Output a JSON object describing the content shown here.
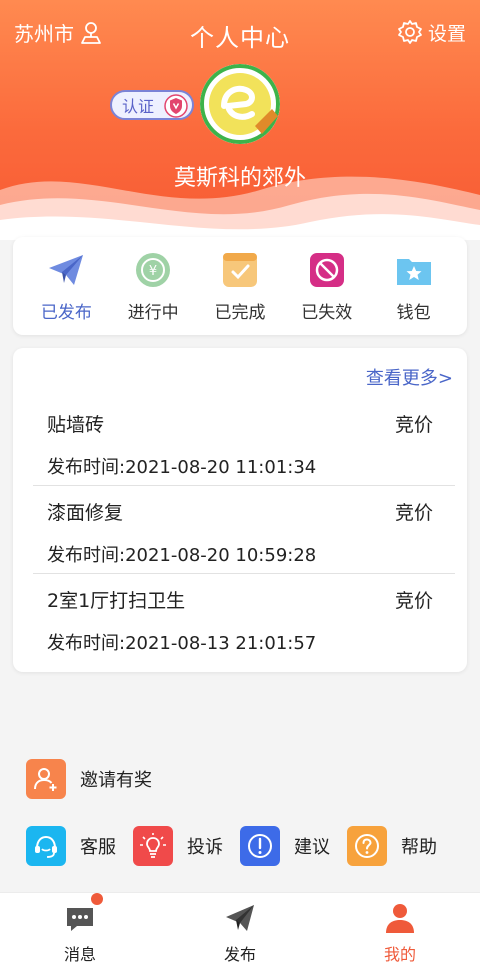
{
  "header": {
    "city": "苏州市",
    "title": "个人中心",
    "settings_label": "设置",
    "verified_label": "认证",
    "username": "莫斯科的郊外"
  },
  "status_tabs": [
    {
      "label": "已发布",
      "icon": "paper-plane-icon",
      "active": true
    },
    {
      "label": "进行中",
      "icon": "coin-icon",
      "active": false
    },
    {
      "label": "已完成",
      "icon": "checkbox-icon",
      "active": false
    },
    {
      "label": "已失效",
      "icon": "prohibited-icon",
      "active": false
    },
    {
      "label": "钱包",
      "icon": "folder-star-icon",
      "active": false
    }
  ],
  "orders": {
    "more_label": "查看更多>",
    "items": [
      {
        "title": "贴墙砖",
        "type": "竞价",
        "time": "发布时间:2021-08-20 11:01:34"
      },
      {
        "title": "漆面修复",
        "type": "竞价",
        "time": "发布时间:2021-08-20 10:59:28"
      },
      {
        "title": "2室1厅打扫卫生",
        "type": "竞价",
        "time": "发布时间:2021-08-13 21:01:57"
      }
    ]
  },
  "services": {
    "invite_label": "邀请有奖",
    "items": [
      {
        "label": "客服",
        "icon": "headset-icon"
      },
      {
        "label": "投诉",
        "icon": "lightbulb-icon"
      },
      {
        "label": "建议",
        "icon": "exclamation-icon"
      },
      {
        "label": "帮助",
        "icon": "question-icon"
      }
    ]
  },
  "bottom_nav": [
    {
      "label": "消息",
      "icon": "chat-icon",
      "active": false,
      "has_badge": true
    },
    {
      "label": "发布",
      "icon": "send-icon",
      "active": false,
      "has_badge": false
    },
    {
      "label": "我的",
      "icon": "user-icon",
      "active": true,
      "has_badge": false
    }
  ],
  "colors": {
    "brand_orange": "#f75a33",
    "accent_blue": "#4a66c8"
  }
}
